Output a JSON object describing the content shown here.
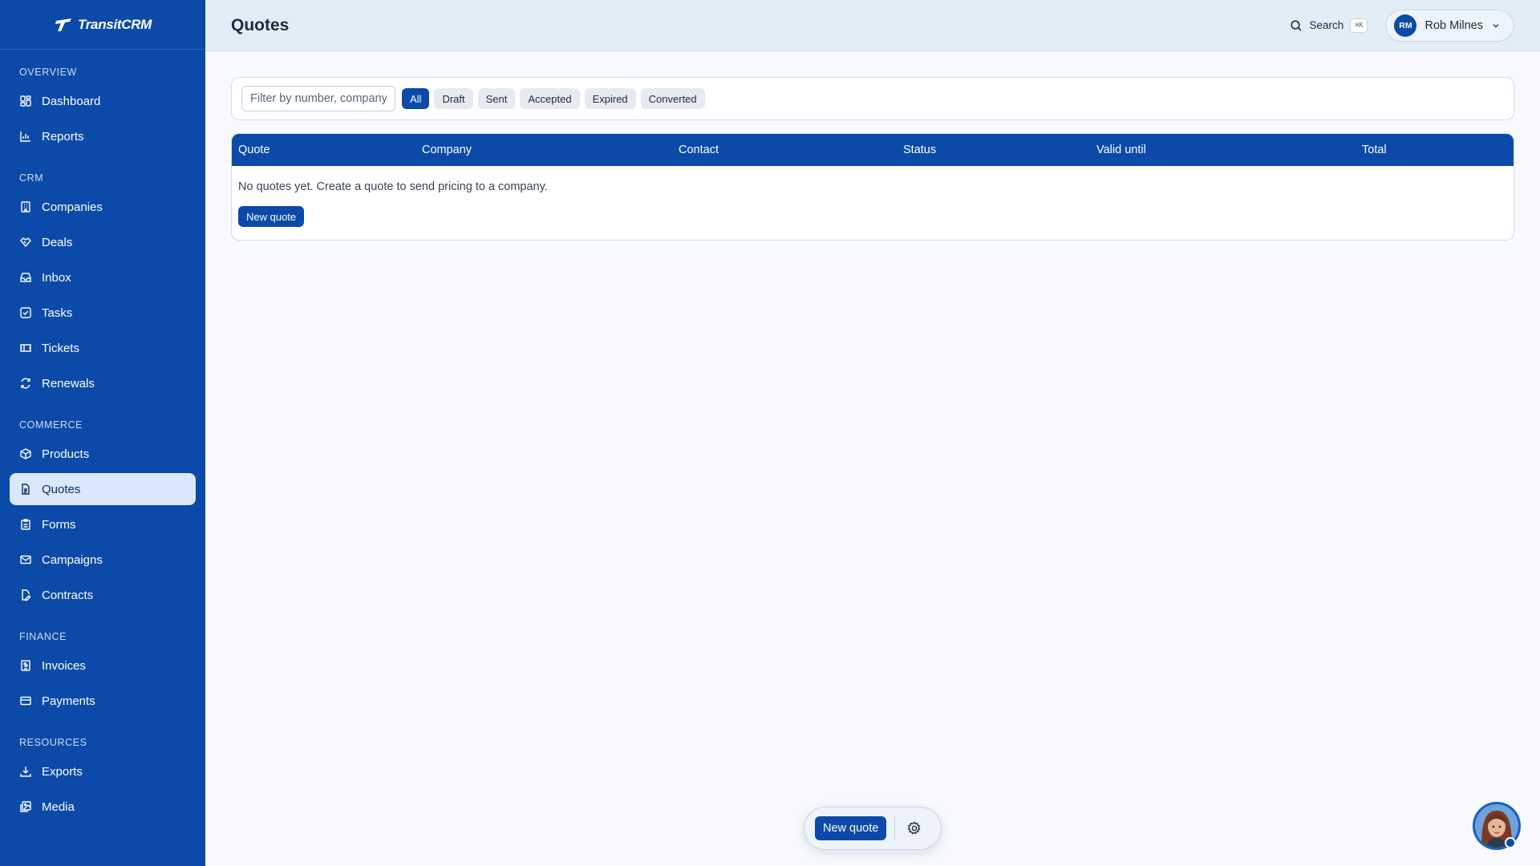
{
  "app": {
    "brand": "TransitCRM"
  },
  "sidebar": {
    "sections": [
      {
        "label": "OVERVIEW",
        "items": [
          {
            "label": "Dashboard",
            "icon": "dashboard-icon"
          },
          {
            "label": "Reports",
            "icon": "bar-chart-icon"
          }
        ]
      },
      {
        "label": "CRM",
        "items": [
          {
            "label": "Companies",
            "icon": "building-icon"
          },
          {
            "label": "Deals",
            "icon": "handshake-icon"
          },
          {
            "label": "Inbox",
            "icon": "inbox-icon"
          },
          {
            "label": "Tasks",
            "icon": "checkbox-icon"
          },
          {
            "label": "Tickets",
            "icon": "ticket-icon"
          },
          {
            "label": "Renewals",
            "icon": "refresh-icon"
          }
        ]
      },
      {
        "label": "COMMERCE",
        "items": [
          {
            "label": "Products",
            "icon": "package-icon"
          },
          {
            "label": "Quotes",
            "icon": "document-icon",
            "active": true
          },
          {
            "label": "Forms",
            "icon": "clipboard-icon"
          },
          {
            "label": "Campaigns",
            "icon": "mail-icon"
          },
          {
            "label": "Contracts",
            "icon": "file-signature-icon"
          }
        ]
      },
      {
        "label": "FINANCE",
        "items": [
          {
            "label": "Invoices",
            "icon": "receipt-icon"
          },
          {
            "label": "Payments",
            "icon": "credit-card-icon"
          }
        ]
      },
      {
        "label": "RESOURCES",
        "items": [
          {
            "label": "Exports",
            "icon": "download-icon"
          },
          {
            "label": "Media",
            "icon": "images-icon"
          }
        ]
      }
    ]
  },
  "header": {
    "title": "Quotes",
    "search_label": "Search",
    "search_shortcut": "⌘K",
    "user": {
      "initials": "RM",
      "name": "Rob Milnes"
    }
  },
  "filters": {
    "placeholder": "Filter by number, company, contact",
    "chips": [
      "All",
      "Draft",
      "Sent",
      "Accepted",
      "Expired",
      "Converted"
    ],
    "active": "All"
  },
  "table": {
    "columns": [
      "Quote",
      "Company",
      "Contact",
      "Status",
      "Valid until",
      "Total"
    ],
    "empty_message": "No quotes yet. Create a quote to send pricing to a company.",
    "empty_action": "New quote"
  },
  "floating_bar": {
    "primary_label": "New quote",
    "settings_icon": "gear-icon"
  },
  "assistant": {
    "icon": "assistant-avatar-icon"
  },
  "colors": {
    "brand": "#0b4aa8",
    "sidebar_active_bg": "#dbe8fb",
    "header_bg": "#e3edf8",
    "page_bg": "#f7f9fc"
  }
}
